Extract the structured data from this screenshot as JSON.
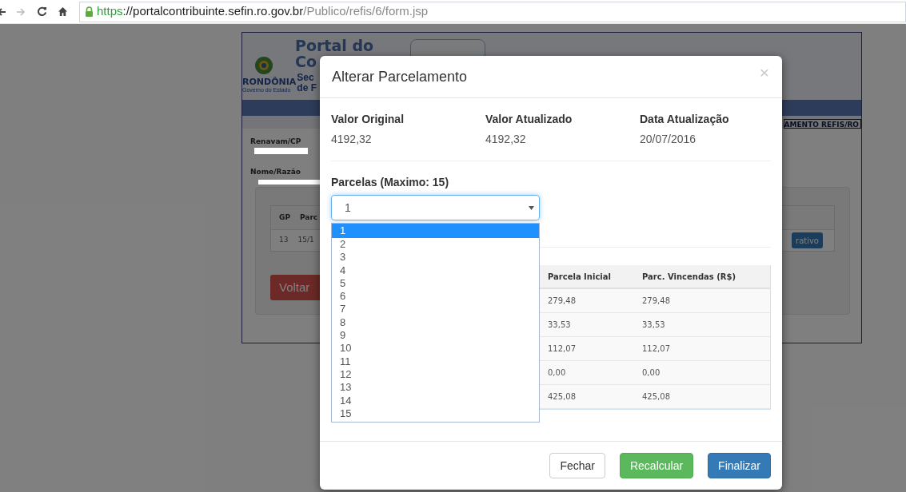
{
  "browser": {
    "url_scheme": "https",
    "url_host": "://portalcontribuinte.sefin.ro.gov.br",
    "url_path": "/Publico/refis/6/form.jsp"
  },
  "background_page": {
    "logo_title": [
      "Portal do",
      "Co"
    ],
    "logo_state": "RONDÔNIA",
    "logo_state_sub": "Governo do Estado",
    "logo_dept": [
      "Sec",
      "de F"
    ],
    "menu_item": "AMENTO REFIS/RO",
    "fields": [
      {
        "label": "Renavam/CP"
      },
      {
        "label": "Nome/Razão"
      }
    ],
    "table": {
      "columns": [
        "GP",
        "Parc"
      ],
      "rows": [
        [
          "13",
          "15/1"
        ]
      ],
      "row_button": "rativo"
    },
    "back_button": "Voltar"
  },
  "modal": {
    "title": "Alterar Parcelamento",
    "close": "×",
    "summary": [
      {
        "label": "Valor Original",
        "value": "4192,32"
      },
      {
        "label": "Valor Atualizado",
        "value": "4192,32"
      },
      {
        "label": "Data Atualização",
        "value": "20/07/2016"
      }
    ],
    "installments_label": "Parcelas (Maximo: 15)",
    "select": {
      "value": "1",
      "expanded": true
    },
    "options": [
      {
        "label": "1",
        "selected": true
      },
      {
        "label": "2",
        "selected": false
      },
      {
        "label": "3",
        "selected": false
      },
      {
        "label": "4",
        "selected": false
      },
      {
        "label": "5",
        "selected": false
      },
      {
        "label": "6",
        "selected": false
      },
      {
        "label": "7",
        "selected": false
      },
      {
        "label": "8",
        "selected": false
      },
      {
        "label": "9",
        "selected": false
      },
      {
        "label": "10",
        "selected": false
      },
      {
        "label": "11",
        "selected": false
      },
      {
        "label": "12",
        "selected": false
      },
      {
        "label": "13",
        "selected": false
      },
      {
        "label": "14",
        "selected": false
      },
      {
        "label": "15",
        "selected": false
      }
    ],
    "table": {
      "columns": [
        "Parcela Inicial",
        "Parc. Vincendas (R$)"
      ],
      "rows": [
        [
          "279,48",
          "279,48"
        ],
        [
          "33,53",
          "33,53"
        ],
        [
          "112,07",
          "112,07"
        ],
        [
          "0,00",
          "0,00"
        ],
        [
          "425,08",
          "425,08"
        ]
      ]
    },
    "buttons": [
      {
        "label": "Fechar",
        "kind": "default"
      },
      {
        "label": "Recalcular",
        "kind": "success"
      },
      {
        "label": "Finalizar",
        "kind": "primary"
      }
    ]
  }
}
